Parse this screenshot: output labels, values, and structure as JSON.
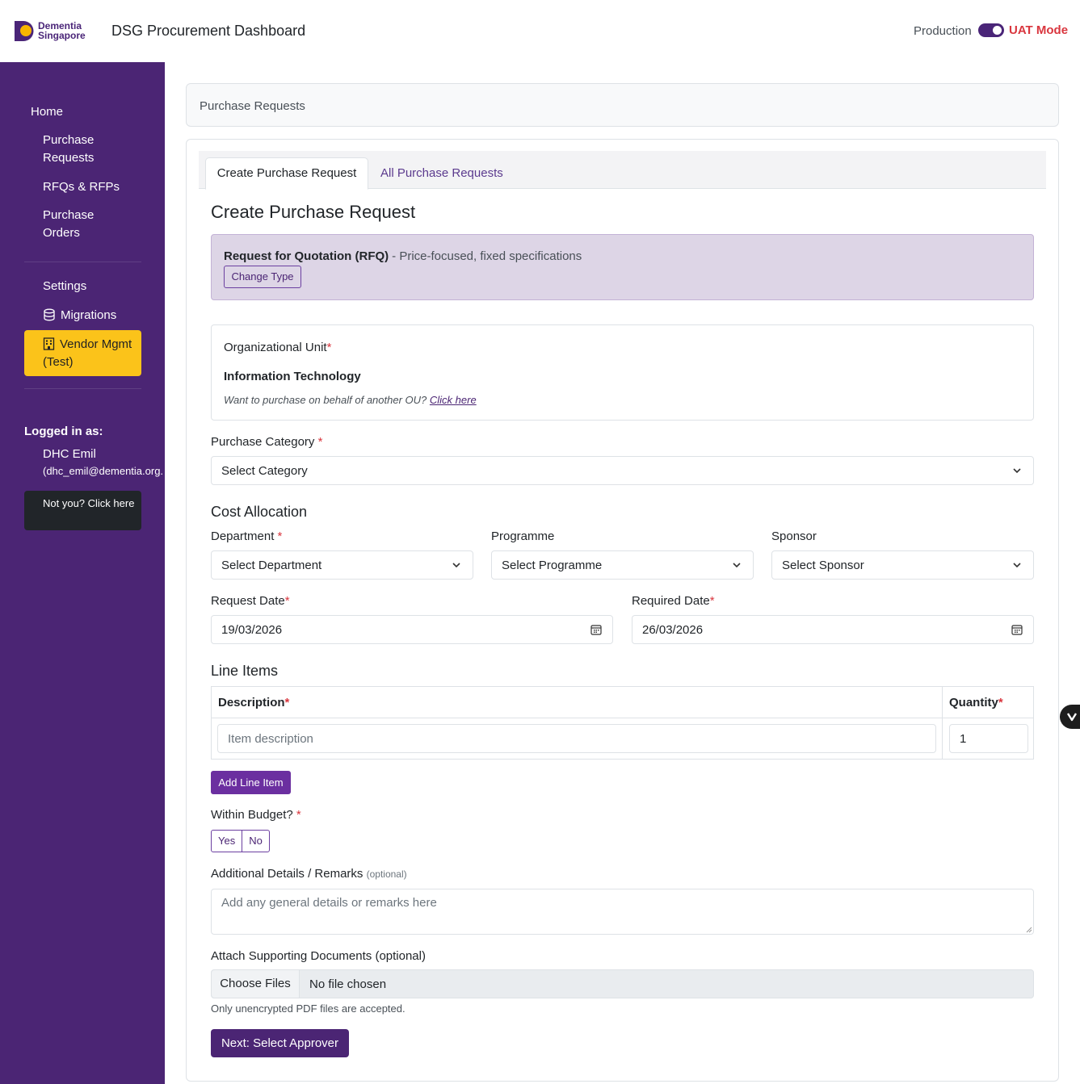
{
  "brand": {
    "logo_line1": "Dementia",
    "logo_line2": "Singapore",
    "logo_color": "#4a2578",
    "logo_accent": "#f7b500"
  },
  "header": {
    "title": "DSG Procurement Dashboard",
    "env_production": "Production",
    "env_uat": "UAT Mode",
    "uat_enabled": true
  },
  "sidebar": {
    "home": "Home",
    "items": [
      {
        "label": "Purchase Requests"
      },
      {
        "label": "RFQs & RFPs"
      },
      {
        "label": "Purchase Orders"
      }
    ],
    "settings": "Settings",
    "migrations": "Migrations",
    "vendor": "Vendor Mgmt (Test)",
    "logged_in_label": "Logged in as:",
    "user_name": "DHC Emil",
    "user_email": "(dhc_emil@dementia.org.",
    "not_you": "Not you? Click here"
  },
  "breadcrumb": "Purchase Requests",
  "tabs": [
    {
      "label": "Create Purchase Request",
      "active": true
    },
    {
      "label": "All Purchase Requests",
      "active": false
    }
  ],
  "form": {
    "heading": "Create Purchase Request",
    "rfq": {
      "title": "Request for Quotation (RFQ)",
      "subtitle": "- Price-focused, fixed specifications",
      "change_type": "Change Type"
    },
    "ou": {
      "label": "Organizational Unit",
      "value": "Information Technology",
      "help": "Want to purchase on behalf of another OU?",
      "help_link": "Click here"
    },
    "purchase_category": {
      "label": "Purchase Category",
      "value": "Select Category"
    },
    "cost_allocation": {
      "heading": "Cost Allocation",
      "department": {
        "label": "Department",
        "value": "Select Department"
      },
      "programme": {
        "label": "Programme",
        "value": "Select Programme"
      },
      "sponsor": {
        "label": "Sponsor",
        "value": "Select Sponsor"
      }
    },
    "request_date": {
      "label": "Request Date",
      "value": "19/03/2026"
    },
    "required_date": {
      "label": "Required Date",
      "value": "26/03/2026"
    },
    "line_items": {
      "heading": "Line Items",
      "col_description": "Description",
      "col_quantity": "Quantity",
      "desc_placeholder": "Item description",
      "qty_value": "1",
      "add_button": "Add Line Item"
    },
    "within_budget": {
      "label": "Within Budget?",
      "yes": "Yes",
      "no": "No"
    },
    "remarks": {
      "label": "Additional Details / Remarks",
      "optional": "(optional)",
      "placeholder": "Add any general details or remarks here"
    },
    "attachments": {
      "label": "Attach Supporting Documents (optional)",
      "choose": "Choose Files",
      "status": "No file chosen",
      "help": "Only unencrypted PDF files are accepted."
    },
    "next_button": "Next: Select Approver"
  },
  "required_mark": "*"
}
